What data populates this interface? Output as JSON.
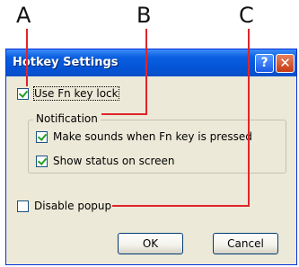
{
  "callouts": [
    "A",
    "B",
    "C"
  ],
  "dialog": {
    "title": "Hotkey Settings",
    "help_glyph": "?",
    "close_glyph": "✕"
  },
  "options": {
    "fn_lock": {
      "label": "Use Fn key lock",
      "checked": true
    },
    "notification_group": "Notification",
    "make_sounds": {
      "label": "Make sounds when Fn key is pressed",
      "checked": true
    },
    "show_status": {
      "label": "Show status on screen",
      "checked": true
    },
    "disable_popup": {
      "label": "Disable popup",
      "checked": false
    }
  },
  "buttons": {
    "ok": "OK",
    "cancel": "Cancel"
  },
  "colors": {
    "leader_line": "#e0242c",
    "title_bar": "#0a5fe0",
    "dialog_bg": "#ece9d8"
  }
}
